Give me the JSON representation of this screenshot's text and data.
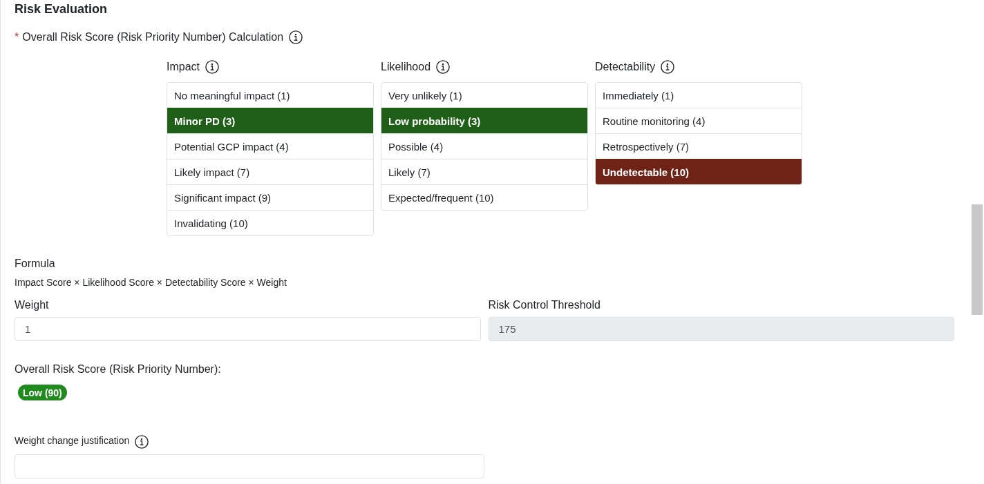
{
  "section_title": "Risk Evaluation",
  "calculation": {
    "required_mark": "*",
    "label": "Overall Risk Score (Risk Priority Number) Calculation",
    "columns": [
      {
        "heading": "Impact",
        "color": "#205f17",
        "options": [
          {
            "label": "No meaningful impact (1)",
            "selected": false
          },
          {
            "label": "Minor PD (3)",
            "selected": true
          },
          {
            "label": "Potential GCP impact (4)",
            "selected": false
          },
          {
            "label": "Likely impact (7)",
            "selected": false
          },
          {
            "label": "Significant impact (9)",
            "selected": false
          },
          {
            "label": "Invalidating (10)",
            "selected": false
          }
        ]
      },
      {
        "heading": "Likelihood",
        "color": "#205f17",
        "options": [
          {
            "label": "Very unlikely (1)",
            "selected": false
          },
          {
            "label": "Low probability (3)",
            "selected": true
          },
          {
            "label": "Possible (4)",
            "selected": false
          },
          {
            "label": "Likely (7)",
            "selected": false
          },
          {
            "label": "Expected/frequent (10)",
            "selected": false
          }
        ]
      },
      {
        "heading": "Detectability",
        "color": "#6e2316",
        "options": [
          {
            "label": "Immediately (1)",
            "selected": false
          },
          {
            "label": "Routine monitoring (4)",
            "selected": false
          },
          {
            "label": "Retrospectively (7)",
            "selected": false
          },
          {
            "label": "Undetectable (10)",
            "selected": true
          }
        ]
      }
    ]
  },
  "formula": {
    "label": "Formula",
    "text": "Impact Score × Likelihood Score × Detectability Score × Weight"
  },
  "fields": [
    {
      "label": "Weight",
      "value": "1",
      "disabled": false
    },
    {
      "label": "Risk Control Threshold",
      "value": "175",
      "disabled": true
    }
  ],
  "overall_score": {
    "label": "Overall Risk Score (Risk Priority Number):",
    "value": "Low (90)",
    "color": "#218a1f"
  },
  "justification": {
    "label": "Weight change justification"
  }
}
